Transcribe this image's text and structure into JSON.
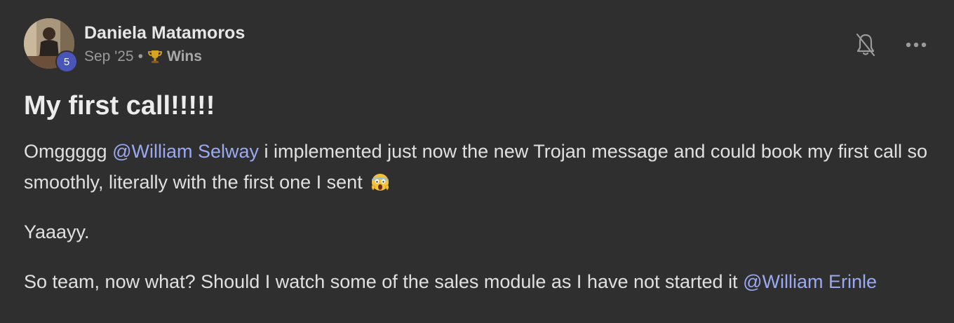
{
  "post": {
    "author": {
      "name": "Daniela Matamoros",
      "level": "5",
      "avatar_icon": "user-photo"
    },
    "meta": {
      "date": "Sep '25",
      "separator": "•",
      "category_icon": "trophy-icon",
      "category": "Wins"
    },
    "actions": {
      "bell_icon": "bell-off-icon",
      "more_icon": "more-horizontal-icon"
    },
    "title": "My first call!!!!!",
    "paragraphs": [
      {
        "before": "Omggggg ",
        "mention": "@William Selway",
        "after": " i implemented just now the new Trojan message and could book my first call so smoothly, literally with the first one I sent",
        "emoji_icon": "screaming-face-emoji"
      },
      {
        "text": "Yaaayy."
      },
      {
        "before": "So team, now what? Should I watch some of the sales module as I have not started it ",
        "mention": "@William Erinle"
      }
    ]
  },
  "colors": {
    "background": "#2f2f2f",
    "mention": "#9aa9f2",
    "badge": "#4a55b8",
    "text": "#e0e0e0",
    "muted": "#9a9a9a"
  }
}
